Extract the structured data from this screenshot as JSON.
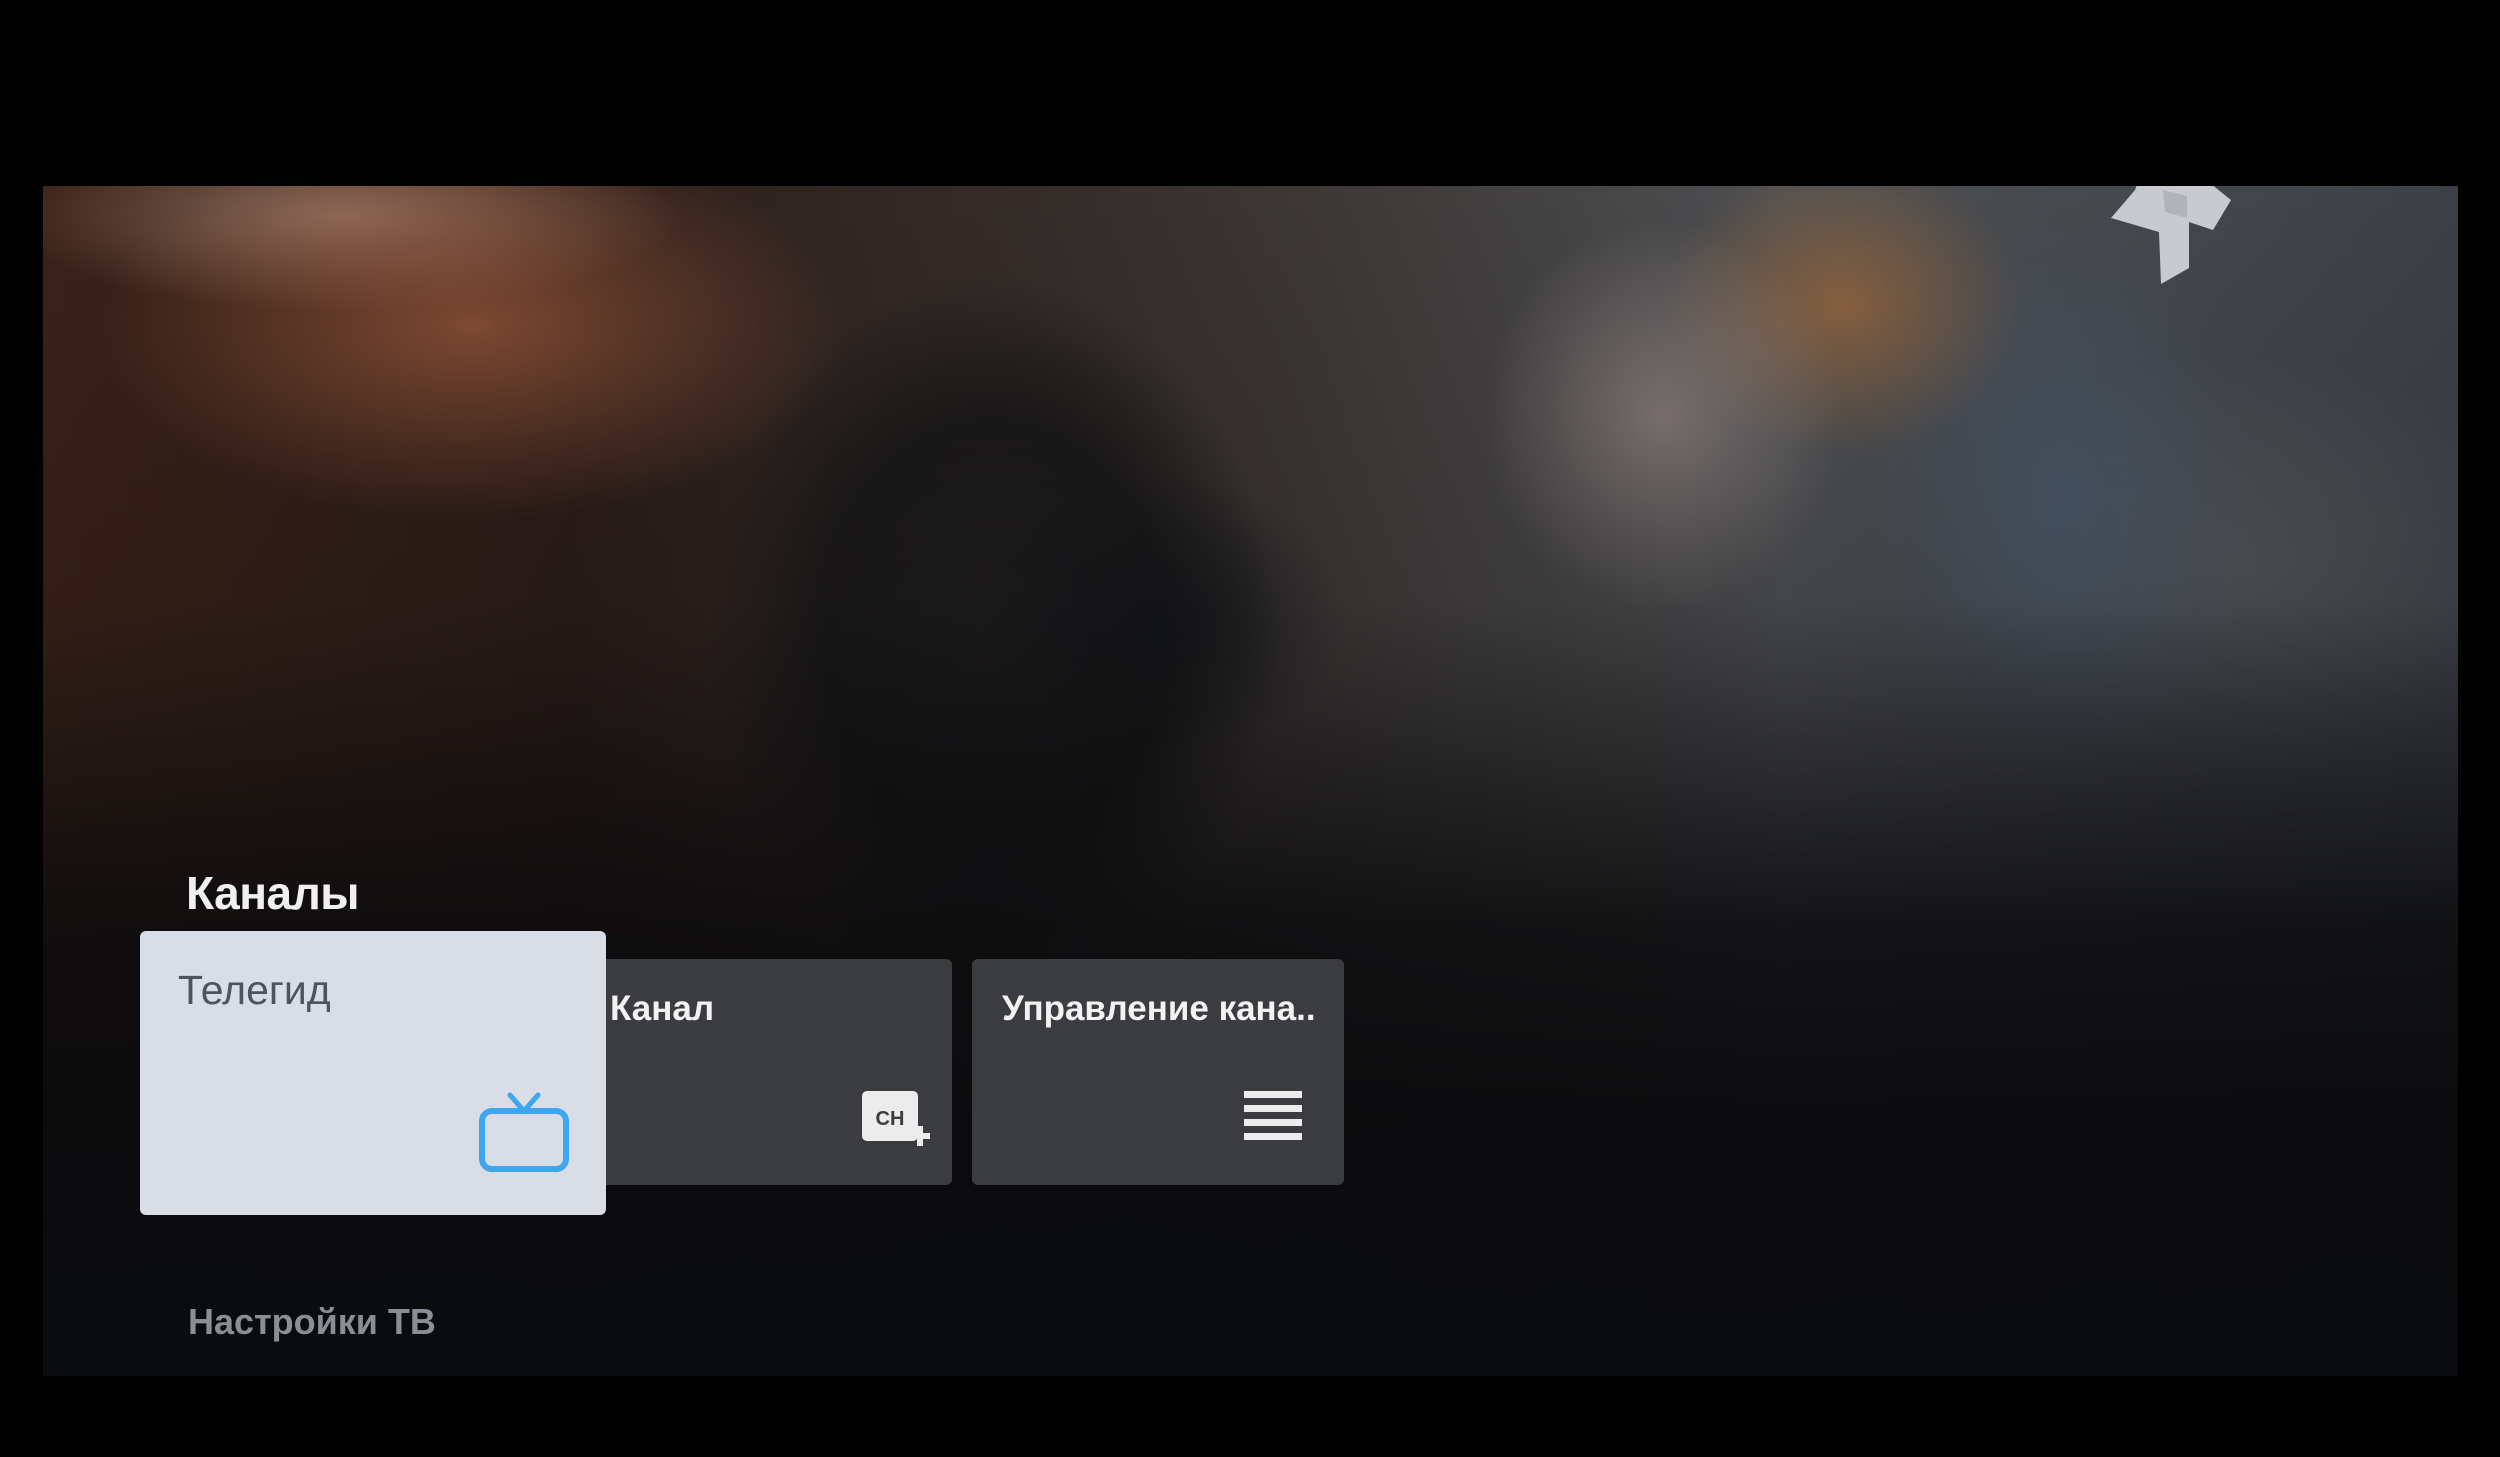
{
  "section": {
    "title": "Каналы"
  },
  "cards": [
    {
      "label": "Телегид",
      "icon": "tv-icon",
      "focused": true
    },
    {
      "label": "Канал",
      "icon": "add-channel-icon",
      "icon_text": "CH"
    },
    {
      "label": "Управление кана..",
      "icon": "list-menu-icon"
    }
  ],
  "settings": {
    "label": "Настройки ТВ"
  },
  "colors": {
    "focused_card_bg": "#d8dde6",
    "card_bg": "#3a3c40",
    "accent_icon": "#3ea6ef"
  }
}
